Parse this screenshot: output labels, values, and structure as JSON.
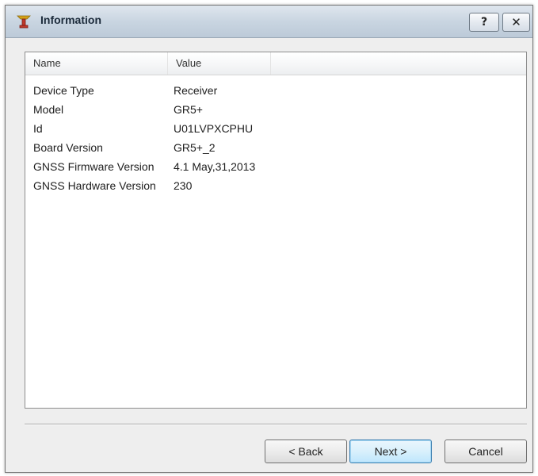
{
  "window": {
    "title": "Information",
    "help_label": "?",
    "close_label": "✕",
    "icon": "app-antenna-icon",
    "icon_colors": {
      "top": "#d4a017",
      "body": "#c0392b"
    }
  },
  "list": {
    "columns": {
      "name": "Name",
      "value": "Value"
    },
    "rows": [
      {
        "name": "Device Type",
        "value": "Receiver"
      },
      {
        "name": "Model",
        "value": "GR5+"
      },
      {
        "name": "Id",
        "value": "U01LVPXCPHU"
      },
      {
        "name": "Board Version",
        "value": "GR5+_2"
      },
      {
        "name": "GNSS Firmware Version",
        "value": "4.1 May,31,2013"
      },
      {
        "name": "GNSS Hardware Version",
        "value": "230"
      }
    ]
  },
  "buttons": {
    "back": "< Back",
    "next": "Next >",
    "cancel": "Cancel"
  }
}
